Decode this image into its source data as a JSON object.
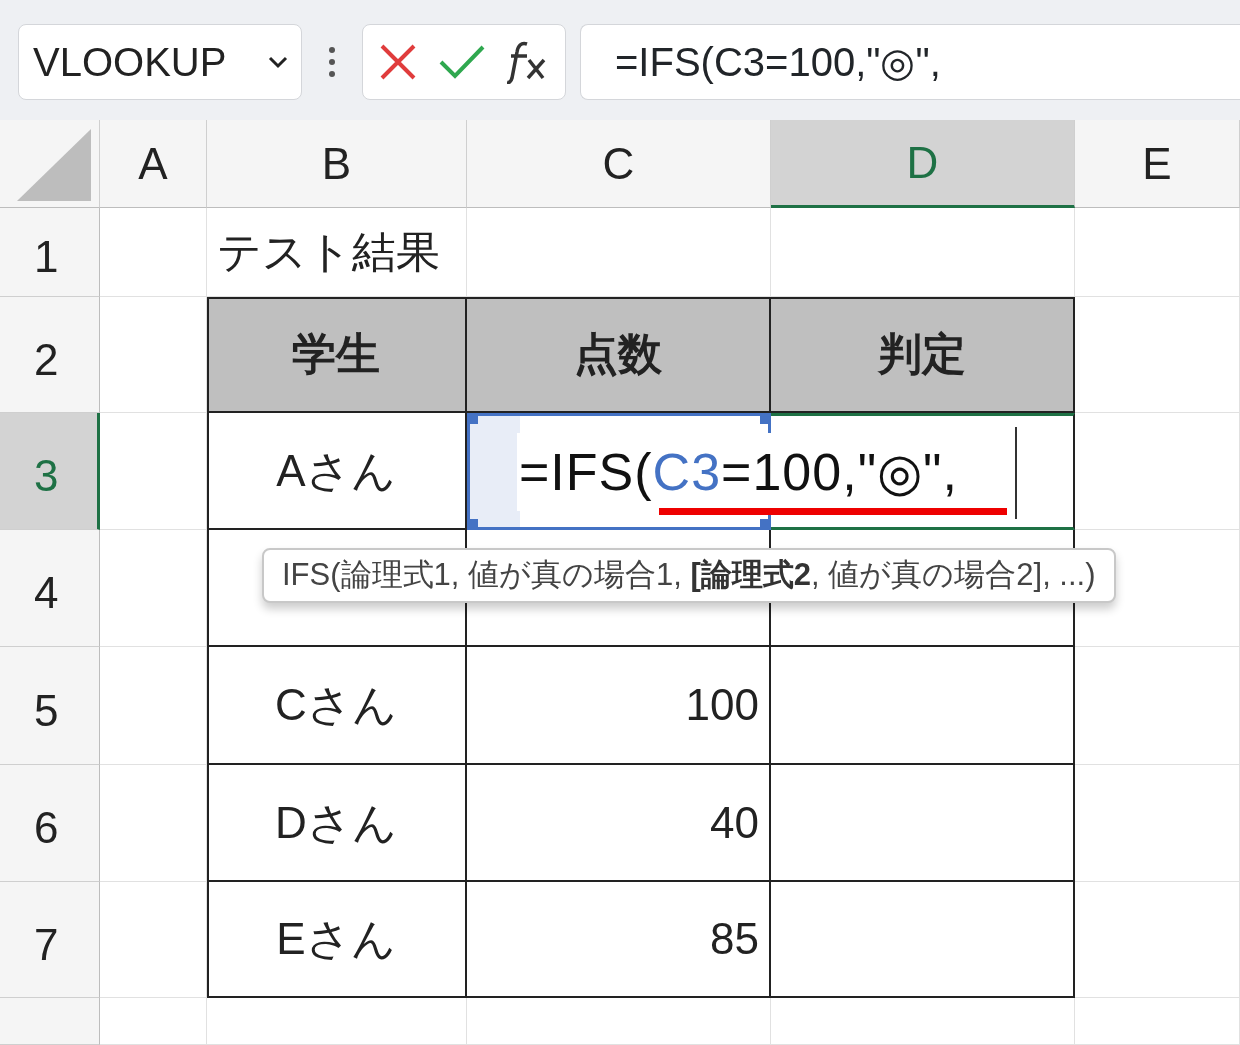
{
  "name_box": {
    "value": "VLOOKUP"
  },
  "formula_bar": {
    "value": "=IFS(C3=100,\"◎\","
  },
  "columns": [
    {
      "label": "A",
      "selected": false
    },
    {
      "label": "B",
      "selected": false
    },
    {
      "label": "C",
      "selected": false
    },
    {
      "label": "D",
      "selected": true
    },
    {
      "label": "E",
      "selected": false
    }
  ],
  "rows": [
    {
      "label": "1",
      "selected": false,
      "kind": "title",
      "title": "テスト結果"
    },
    {
      "label": "2",
      "selected": false,
      "kind": "header",
      "headers": [
        "学生",
        "点数",
        "判定"
      ]
    },
    {
      "label": "3",
      "selected": true,
      "kind": "editing",
      "student": "Aさん",
      "formula_parts": [
        {
          "text": "=IFS(",
          "reference": false
        },
        {
          "text": "C3",
          "reference": true
        },
        {
          "text": "=100,\"◎\",",
          "reference": false
        }
      ]
    },
    {
      "label": "4",
      "selected": false,
      "kind": "data"
    },
    {
      "label": "5",
      "selected": false,
      "kind": "data",
      "student": "Cさん",
      "score": "100"
    },
    {
      "label": "6",
      "selected": false,
      "kind": "data",
      "student": "Dさん",
      "score": "40"
    },
    {
      "label": "7",
      "selected": false,
      "kind": "data",
      "student": "Eさん",
      "score": "85"
    },
    {
      "label": "",
      "selected": false,
      "kind": "blank"
    }
  ],
  "tooltip": {
    "text": "IFS(論理式1, 値が真の場合1, **[論理式2**, 値が真の場合2], ...)"
  }
}
